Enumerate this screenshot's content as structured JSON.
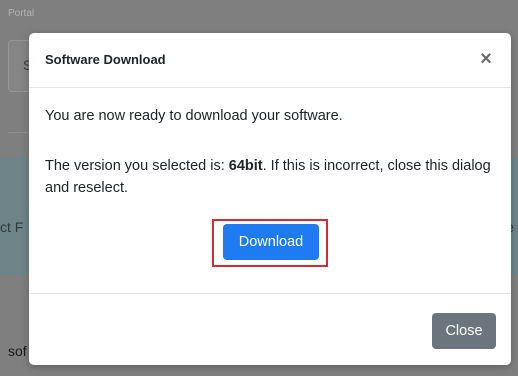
{
  "background": {
    "portal_label": "Portal",
    "input_text": "S",
    "band_text_left": "ct F",
    "band_text_right": "e",
    "bottom_text": "sof"
  },
  "modal": {
    "title": "Software Download",
    "close_icon": "×",
    "message_ready": "You are now ready to download your software.",
    "version_prefix": "The version you selected is: ",
    "version_value": "64bit",
    "version_suffix": ". If this is incorrect, close this dialog and reselect.",
    "download_label": "Download",
    "close_label": "Close"
  },
  "colors": {
    "primary": "#1f7bf2",
    "secondary": "#6c757d",
    "highlight": "#d62b32"
  }
}
